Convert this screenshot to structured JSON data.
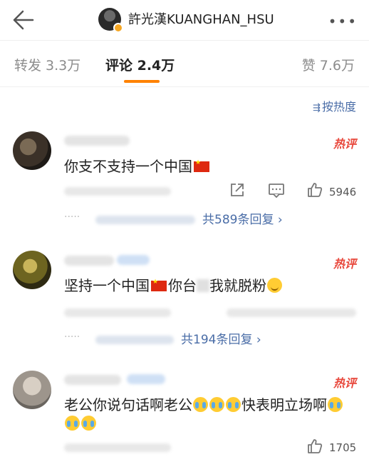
{
  "header": {
    "title": "許光漢KUANGHAN_HSU",
    "back_icon": "arrow-left-icon",
    "more_icon": "more-dots-icon",
    "more_glyph": "•••"
  },
  "tabs": {
    "repost": "转发 3.3万",
    "comment": "评论 2.4万",
    "like": "赞 7.6万",
    "active_color": "#ff8200"
  },
  "sort": {
    "label": "按热度",
    "icon": "sort-icon"
  },
  "comments": [
    {
      "hot_label": "热评",
      "text_a": "你支不支持一个中国",
      "like_count": "5946",
      "reply_dots": "·····",
      "reply_link": "共589条回复 ›"
    },
    {
      "hot_label": "热评",
      "text_a": "坚持一个中国",
      "text_b": "你台",
      "text_c": "我就脱粉",
      "reply_dots": "·····",
      "reply_link": "共194条回复 ›"
    },
    {
      "hot_label": "热评",
      "text_a": "老公你说句话啊老公",
      "text_b": "快表明立场啊",
      "like_count": "1705"
    }
  ],
  "colors": {
    "hot": "#e8483c",
    "link": "#4a6da7"
  }
}
